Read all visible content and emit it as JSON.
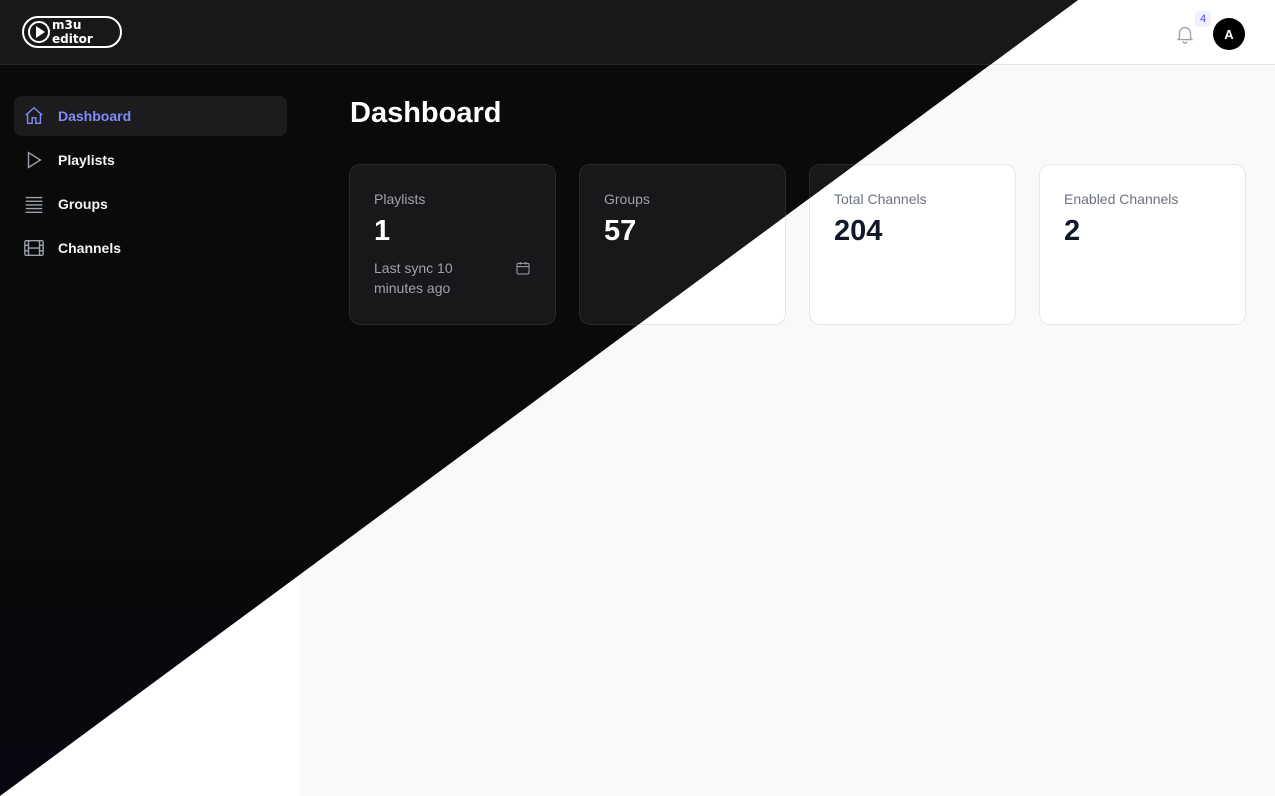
{
  "app": {
    "logo_text": "m3u editor"
  },
  "header": {
    "notifications_count": "4",
    "avatar_initial": "A"
  },
  "sidebar": {
    "items": [
      {
        "label": "Dashboard",
        "icon": "home-icon",
        "active": true
      },
      {
        "label": "Playlists",
        "icon": "play-icon",
        "active": false
      },
      {
        "label": "Groups",
        "icon": "list-icon",
        "active": false
      },
      {
        "label": "Channels",
        "icon": "film-icon",
        "active": false
      }
    ]
  },
  "main": {
    "title": "Dashboard",
    "cards": [
      {
        "label": "Playlists",
        "value": "1",
        "description": "Last sync 10 minutes ago",
        "icon": "calendar-icon"
      },
      {
        "label": "Groups",
        "value": "57"
      },
      {
        "label": "Total Channels",
        "value": "204"
      },
      {
        "label": "Enabled Channels",
        "value": "2"
      }
    ]
  },
  "colors": {
    "accent": "#6366f1",
    "dark_bg": "#0a0a0a",
    "light_bg": "#f9f9f9"
  }
}
